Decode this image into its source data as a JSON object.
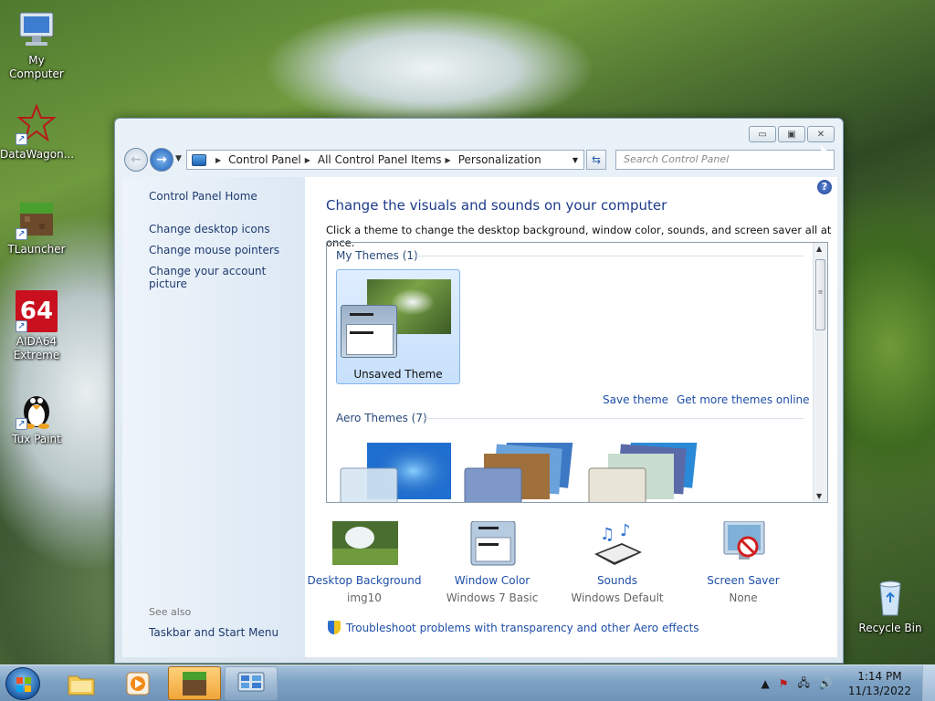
{
  "desktop": {
    "icons": [
      {
        "label": "My Computer"
      },
      {
        "label": "DataWagon..."
      },
      {
        "label": "TLauncher"
      },
      {
        "label": "AIDA64 Extreme"
      },
      {
        "label": "Tux Paint"
      },
      {
        "label": "Recycle Bin"
      }
    ],
    "aida_logo": "64"
  },
  "window": {
    "controls": {
      "minimize": "▭",
      "maximize": "▣",
      "close": "✕"
    },
    "breadcrumb": [
      "Control Panel",
      "All Control Panel Items",
      "Personalization"
    ],
    "search_placeholder": "Search Control Panel",
    "sidebar": {
      "home": "Control Panel Home",
      "links": [
        "Change desktop icons",
        "Change mouse pointers",
        "Change your account picture"
      ],
      "see_also": "See also",
      "see_also_links": [
        "Taskbar and Start Menu"
      ]
    },
    "heading": "Change the visuals and sounds on your computer",
    "subtext": "Click a theme to change the desktop background, window color, sounds, and screen saver all at once.",
    "my_themes": {
      "header": "My Themes (1)",
      "items": [
        {
          "label": "Unsaved Theme",
          "selected": true
        }
      ],
      "save_theme": "Save theme",
      "get_more": "Get more themes online"
    },
    "aero_themes": {
      "header": "Aero Themes (7)"
    },
    "bottom": [
      {
        "label": "Desktop Background",
        "value": "img10",
        "icon": "desktop-background-icon"
      },
      {
        "label": "Window Color",
        "value": "Windows 7 Basic",
        "icon": "window-color-icon"
      },
      {
        "label": "Sounds",
        "value": "Windows Default",
        "icon": "sounds-icon"
      },
      {
        "label": "Screen Saver",
        "value": "None",
        "icon": "screen-saver-icon"
      }
    ],
    "troubleshoot": "Troubleshoot problems with transparency and other Aero effects"
  },
  "taskbar": {
    "clock_time": "1:14 PM",
    "clock_date": "11/13/2022"
  },
  "colors": {
    "accent_link": "#1e4fa8",
    "heading": "#1e3b8a",
    "taskbar": "#7ea2c4"
  }
}
